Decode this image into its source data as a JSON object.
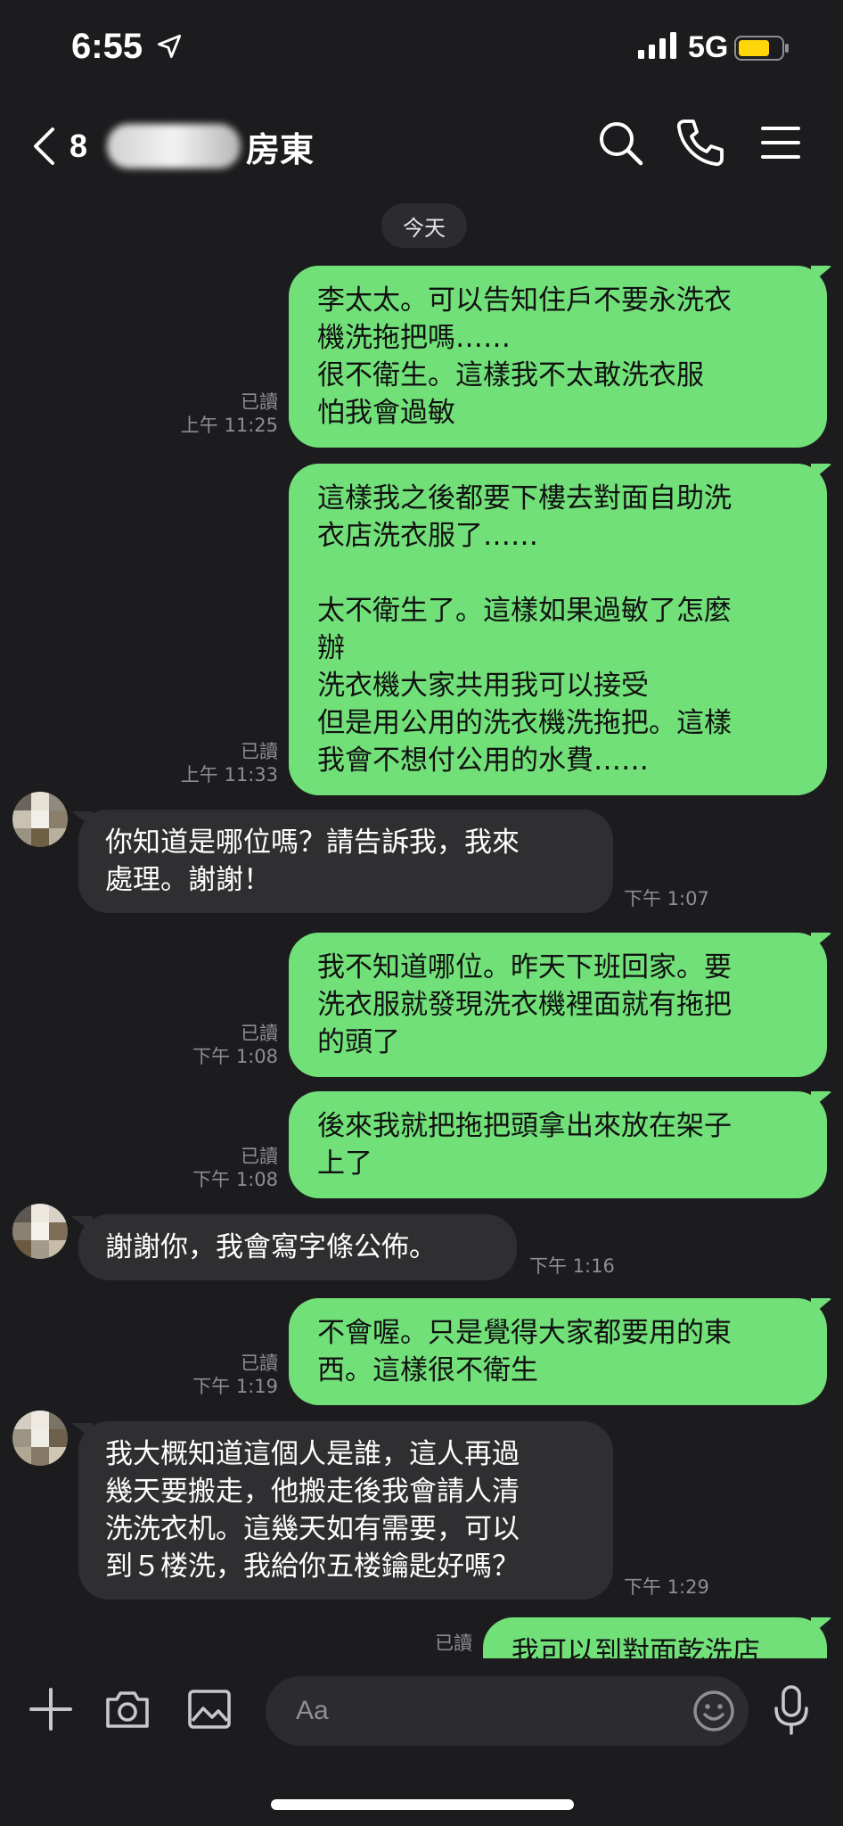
{
  "status_bar": {
    "time": "6:55",
    "network": "5G"
  },
  "header": {
    "back_count": "8",
    "chat_name": "房東"
  },
  "chat": {
    "date_label": "今天",
    "messages": [
      {
        "text": "李太太。可以告知住戶不要永洗衣\n機洗拖把嗎……\n很不衛生。這樣我不太敢洗衣服\n怕我會過敏",
        "read": "已讀",
        "time": "上午 11:25"
      },
      {
        "text": "這樣我之後都要下樓去對面自助洗\n衣店洗衣服了……\n\n太不衛生了。這樣如果過敏了怎麼\n辦\n洗衣機大家共用我可以接受\n但是用公用的洗衣機洗拖把。這樣\n我會不想付公用的水費……",
        "read": "已讀",
        "time": "上午 11:33"
      },
      {
        "text": "你知道是哪位嗎？請告訴我，我來\n處理。謝謝！",
        "time": "下午 1:07"
      },
      {
        "text": "我不知道哪位。昨天下班回家。要\n洗衣服就發現洗衣機裡面就有拖把\n的頭了",
        "read": "已讀",
        "time": "下午 1:08"
      },
      {
        "text": "後來我就把拖把頭拿出來放在架子\n上了",
        "read": "已讀",
        "time": "下午 1:08"
      },
      {
        "text": "謝謝你，我會寫字條公佈。",
        "time": "下午 1:16"
      },
      {
        "text": "不會喔。只是覺得大家都要用的東\n西。這樣很不衛生",
        "read": "已讀",
        "time": "下午 1:19"
      },
      {
        "text": "我大概知道這個人是誰，這人再過\n幾天要搬走，他搬走後我會請人清\n洗洗衣机。這幾天如有需要，可以\n到５楼洗，我給你五楼鑰匙好嗎？",
        "time": "下午 1:29"
      },
      {
        "text": "我可以到對面乾洗店",
        "read": "已讀"
      }
    ]
  },
  "input": {
    "placeholder": "Aa"
  },
  "icons": {
    "back": "chevron-left-icon",
    "search": "search-icon",
    "call": "phone-icon",
    "menu": "menu-icon",
    "plus": "plus-icon",
    "camera": "camera-icon",
    "image": "image-icon",
    "emoji": "emoji-icon",
    "mic": "mic-icon"
  },
  "colors": {
    "outgoing_bubble": "#71e079",
    "incoming_bubble": "#2f2f31",
    "background": "#1c1c1e",
    "battery": "#ffd60a"
  }
}
